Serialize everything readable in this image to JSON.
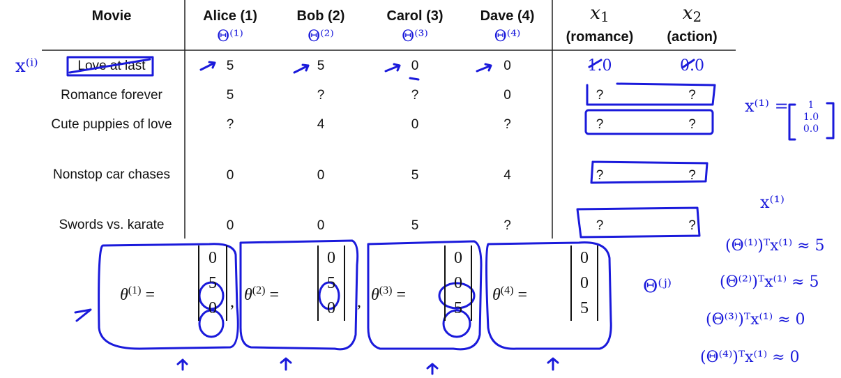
{
  "table": {
    "headers": {
      "movie": "Movie",
      "alice": "Alice (1)",
      "bob": "Bob (2)",
      "carol": "Carol (3)",
      "dave": "Dave (4)",
      "x1": "x",
      "x1_sub": "1",
      "x1_label": "(romance)",
      "x2": "x",
      "x2_sub": "2",
      "x2_label": "(action)"
    },
    "rows": [
      {
        "movie": "Love at last",
        "alice": "5",
        "bob": "5",
        "carol": "0",
        "dave": "0",
        "x1": "1.0",
        "x2": "0.0"
      },
      {
        "movie": "Romance forever",
        "alice": "5",
        "bob": "?",
        "carol": "?",
        "dave": "0",
        "x1": "?",
        "x2": "?"
      },
      {
        "movie": "Cute puppies of love",
        "alice": "?",
        "bob": "4",
        "carol": "0",
        "dave": "?",
        "x1": "?",
        "x2": "?"
      },
      {
        "movie": "Nonstop car chases",
        "alice": "0",
        "bob": "0",
        "carol": "5",
        "dave": "4",
        "x1": "?",
        "x2": "?"
      },
      {
        "movie": "Swords vs. karate",
        "alice": "0",
        "bob": "0",
        "carol": "5",
        "dave": "?",
        "x1": "?",
        "x2": "?"
      }
    ]
  },
  "thetas": [
    {
      "name": "θ",
      "sup": "(1)",
      "eq": "=",
      "values": [
        "0",
        "5",
        "0"
      ]
    },
    {
      "name": "θ",
      "sup": "(2)",
      "eq": "=",
      "values": [
        "0",
        "5",
        "0"
      ]
    },
    {
      "name": "θ",
      "sup": "(3)",
      "eq": "=",
      "values": [
        "0",
        "0",
        "5"
      ]
    },
    {
      "name": "θ",
      "sup": "(4)",
      "eq": "=",
      "values": [
        "0",
        "0",
        "5"
      ]
    }
  ],
  "annotations": {
    "theta_alice": "Θ⁽¹⁾",
    "theta_bob": "Θ⁽²⁾",
    "theta_carol": "Θ⁽³⁾",
    "theta_dave": "Θ⁽⁴⁾",
    "x_i": "x⁽ⁱ⁾",
    "x1_vec_label": "x⁽¹⁾ =",
    "x1_vec": [
      "1",
      "1.0",
      "0.0"
    ],
    "x1_side": "x⁽¹⁾",
    "theta_j": "Θ⁽ʲ⁾",
    "eq1": "(Θ⁽¹⁾)ᵀx⁽¹⁾ ≈ 5",
    "eq2": "(Θ⁽²⁾)ᵀx⁽¹⁾ ≈ 5",
    "eq3": "(Θ⁽³⁾)ᵀx⁽¹⁾ ≈ 0",
    "eq4": "(Θ⁽⁴⁾)ᵀx⁽¹⁾ ≈ 0",
    "r1_x1": "1.0",
    "r1_x2": "0.0",
    "comma": ","
  },
  "colors": {
    "ink": "#1a1adb",
    "rule": "#222222"
  }
}
